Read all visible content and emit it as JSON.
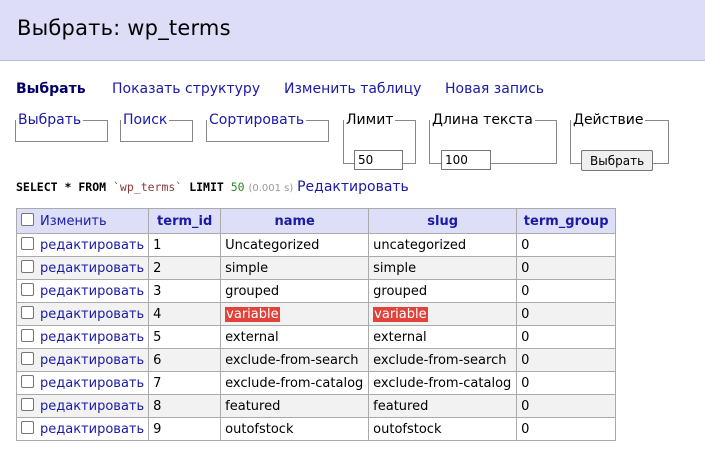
{
  "header": {
    "title": "Выбрать: wp_terms"
  },
  "menu": {
    "select": "Выбрать",
    "structure": "Показать структуру",
    "alter": "Изменить таблицу",
    "new_item": "Новая запись"
  },
  "filters": {
    "select_legend": "Выбрать",
    "search_legend": "Поиск",
    "sort_legend": "Сортировать",
    "limit_legend": "Лимит",
    "limit_value": "50",
    "text_length_legend": "Длина текста",
    "text_length_value": "100",
    "action_legend": "Действие",
    "action_button": "Выбрать"
  },
  "query": {
    "kw_select": "SELECT",
    "star": "*",
    "kw_from": "FROM",
    "table": "`wp_terms`",
    "kw_limit": "LIMIT",
    "limit": "50",
    "time": "(0.001 s)",
    "edit_link": "Редактировать"
  },
  "table": {
    "columns": [
      "Изменить",
      "term_id",
      "name",
      "slug",
      "term_group"
    ],
    "edit_label": "редактировать",
    "rows": [
      {
        "term_id": "1",
        "name": "Uncategorized",
        "slug": "uncategorized",
        "term_group": "0"
      },
      {
        "term_id": "2",
        "name": "simple",
        "slug": "simple",
        "term_group": "0"
      },
      {
        "term_id": "3",
        "name": "grouped",
        "slug": "grouped",
        "term_group": "0"
      },
      {
        "term_id": "4",
        "name": "variable",
        "slug": "variable",
        "term_group": "0"
      },
      {
        "term_id": "5",
        "name": "external",
        "slug": "external",
        "term_group": "0"
      },
      {
        "term_id": "6",
        "name": "exclude-from-search",
        "slug": "exclude-from-search",
        "term_group": "0"
      },
      {
        "term_id": "7",
        "name": "exclude-from-catalog",
        "slug": "exclude-from-catalog",
        "term_group": "0"
      },
      {
        "term_id": "8",
        "name": "featured",
        "slug": "featured",
        "term_group": "0"
      },
      {
        "term_id": "9",
        "name": "outofstock",
        "slug": "outofstock",
        "term_group": "0"
      }
    ]
  }
}
